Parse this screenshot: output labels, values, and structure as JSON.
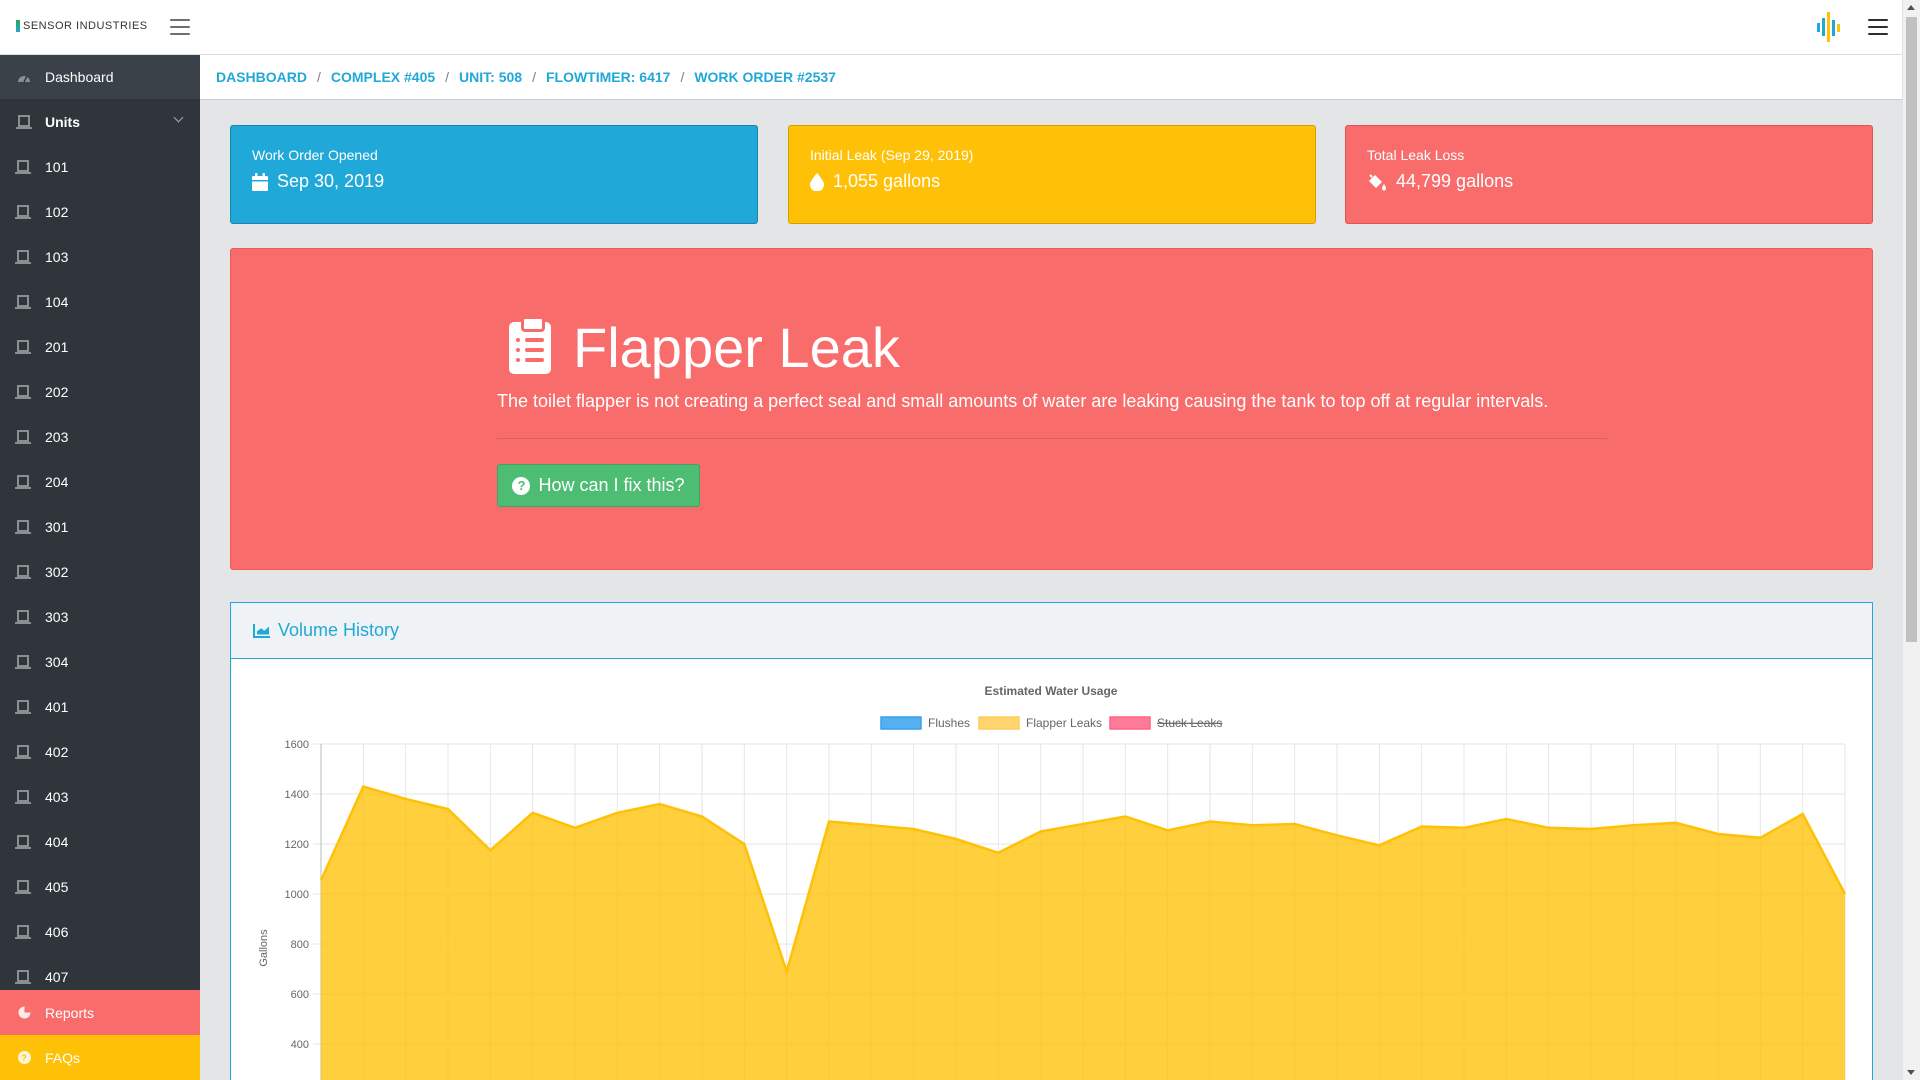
{
  "app": {
    "logo_text": "SENSOR INDUSTRIES"
  },
  "sidebar": {
    "dashboard_label": "Dashboard",
    "units_label": "Units",
    "units": [
      "101",
      "102",
      "103",
      "104",
      "201",
      "202",
      "203",
      "204",
      "301",
      "302",
      "303",
      "304",
      "401",
      "402",
      "403",
      "404",
      "405",
      "406",
      "407"
    ],
    "reports_label": "Reports",
    "faqs_label": "FAQs"
  },
  "breadcrumb": {
    "items": [
      "DASHBOARD",
      "COMPLEX #405",
      "UNIT: 508",
      "FLOWTIMER: 6417",
      "WORK ORDER #2537"
    ],
    "separator": "/"
  },
  "cards": {
    "opened": {
      "label": "Work Order Opened",
      "value": "Sep 30, 2019",
      "icon": "calendar-icon"
    },
    "initial": {
      "label": "Initial Leak (Sep 29, 2019)",
      "value": "1,055 gallons",
      "icon": "droplet-icon"
    },
    "total": {
      "label": "Total Leak Loss",
      "value": "44,799 gallons",
      "icon": "paint-bucket-icon"
    }
  },
  "leak": {
    "title": "Flapper Leak",
    "description": "The toilet flapper is not creating a perfect seal and small amounts of water are leaking causing the tank to top off at regular intervals.",
    "button_label": "How can I fix this?"
  },
  "volume": {
    "title": "Volume History"
  },
  "colors": {
    "primary": "#20a8d8",
    "warning": "#ffc107",
    "danger": "#f86c6b",
    "success": "#4dbd74",
    "sidebar": "#2f353a"
  },
  "chart_data": {
    "type": "area",
    "title": "Estimated Water Usage",
    "ylabel": "Gallons",
    "xlabel": "",
    "ylim": [
      0,
      1600
    ],
    "yticks": [
      400,
      600,
      800,
      1000,
      1200,
      1400,
      1600
    ],
    "grid": true,
    "legend": [
      {
        "name": "Flushes",
        "color": "#36a2eb",
        "hidden": false
      },
      {
        "name": "Flapper Leaks",
        "color": "#ffcd56",
        "hidden": false
      },
      {
        "name": "Stuck Leaks",
        "color": "#ff6384",
        "hidden": true
      }
    ],
    "series": [
      {
        "name": "Flapper Leaks",
        "values": [
          1055,
          1430,
          1380,
          1340,
          1175,
          1325,
          1265,
          1325,
          1360,
          1310,
          1200,
          690,
          1290,
          1275,
          1260,
          1220,
          1165,
          1250,
          1280,
          1310,
          1255,
          1290,
          1275,
          1280,
          1235,
          1195,
          1270,
          1265,
          1300,
          1265,
          1260,
          1275,
          1285,
          1240,
          1225,
          1320,
          1000
        ]
      }
    ]
  }
}
